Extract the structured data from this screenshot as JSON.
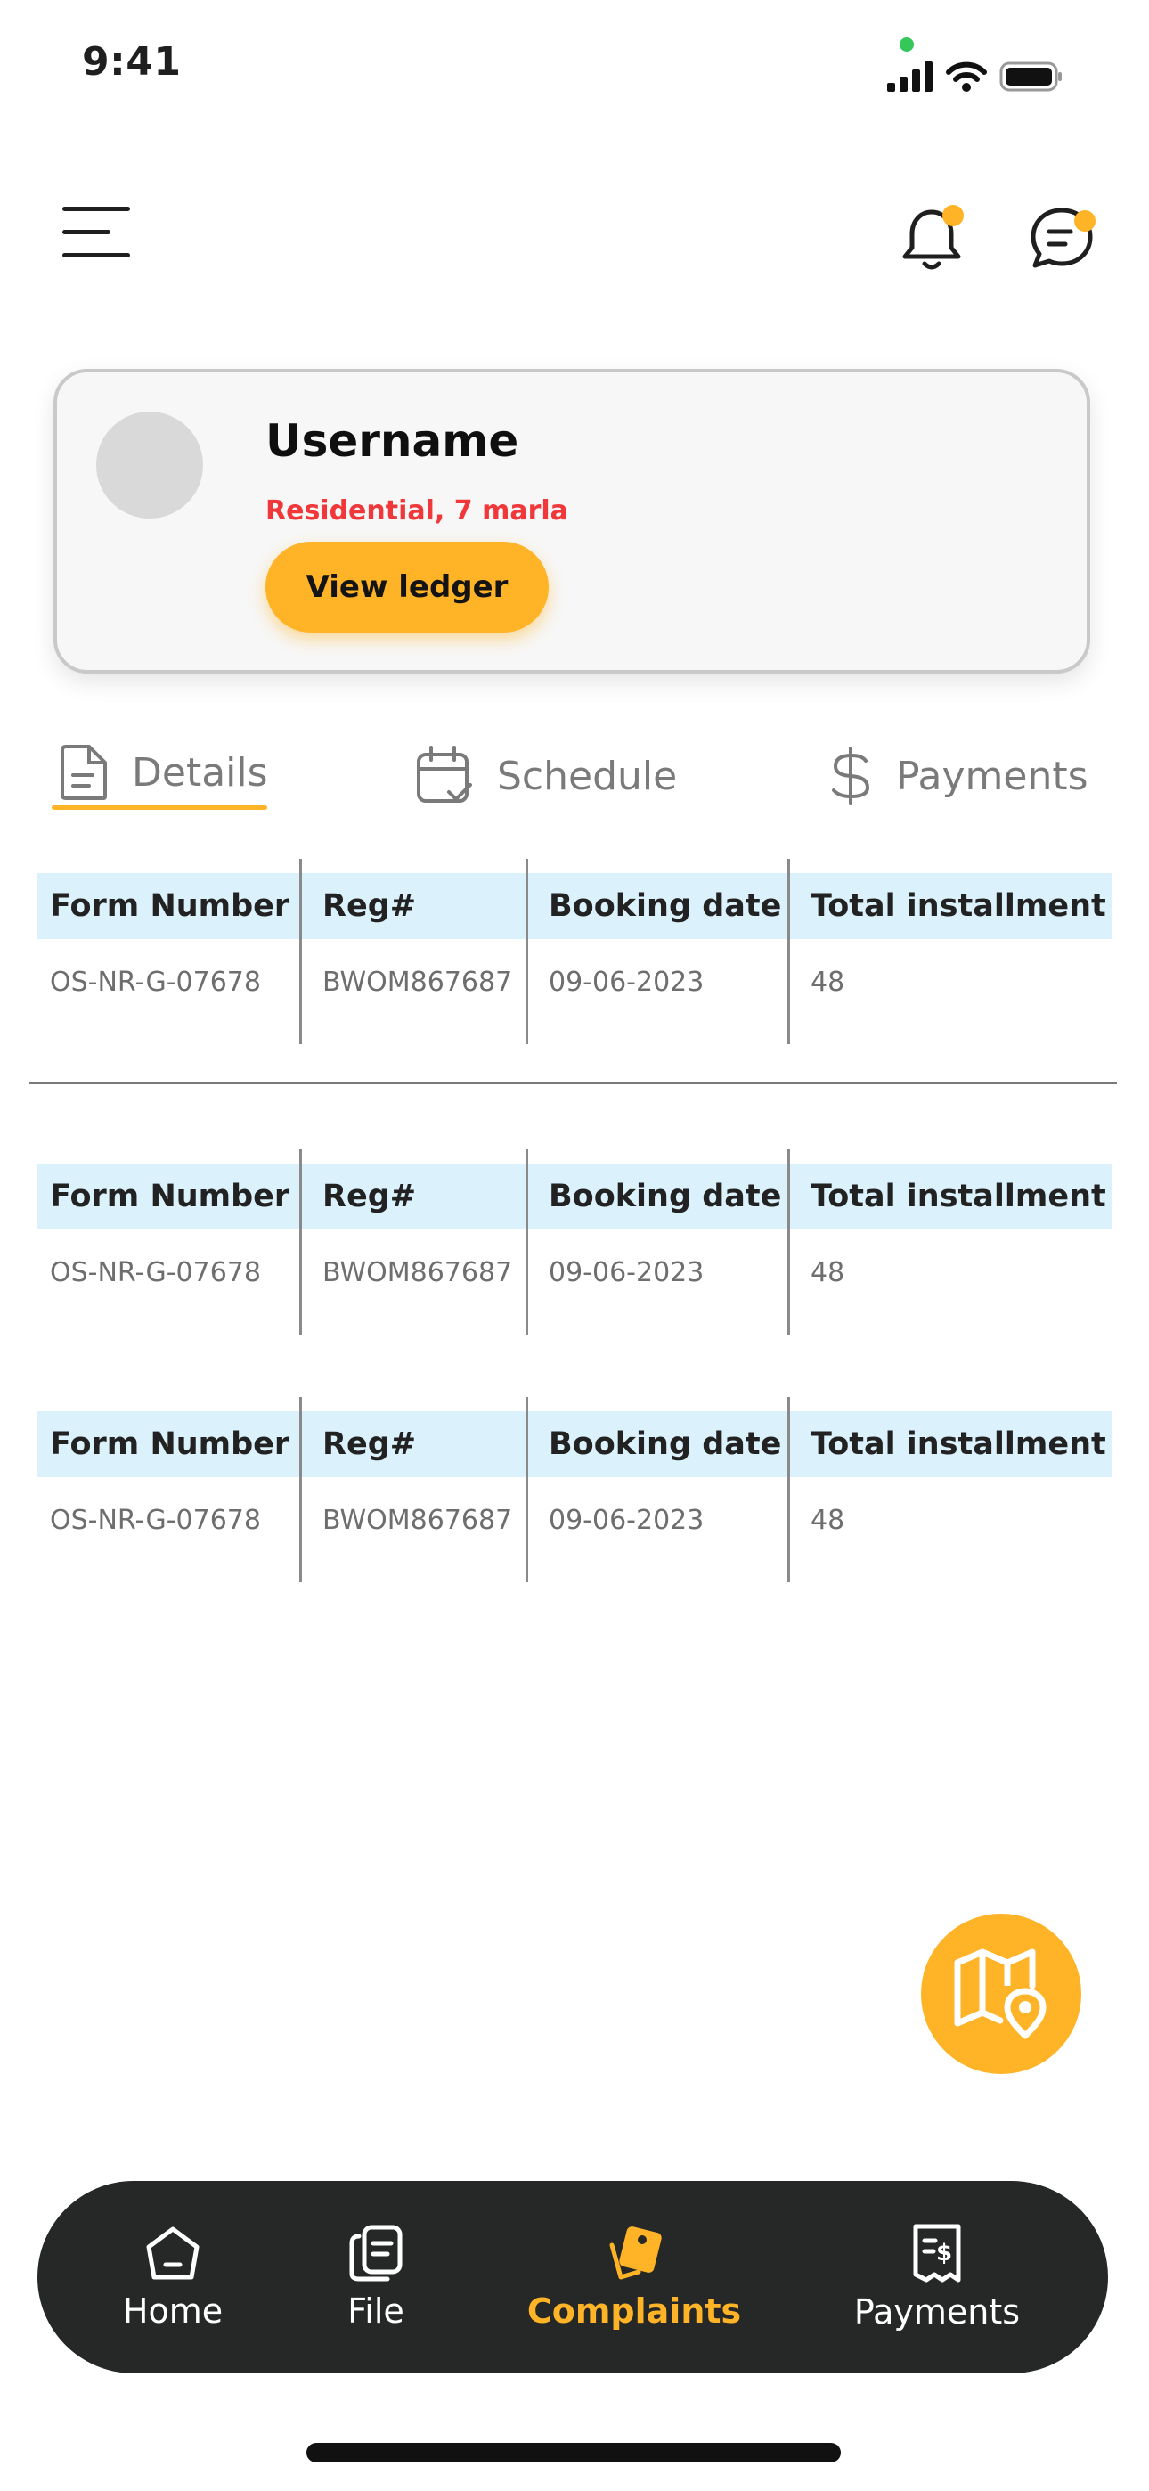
{
  "status_bar": {
    "time": "9:41"
  },
  "header": {
    "menu_icon": "hamburger-menu-icon",
    "notifications_icon": "bell-icon",
    "messages_icon": "chat-bubble-icon",
    "badge_color": "#ffb326"
  },
  "profile": {
    "username": "Username",
    "subtitle": "Residential, 7 marla",
    "view_ledger_label": "View ledger"
  },
  "tabs": [
    {
      "label": "Details",
      "icon": "document-icon",
      "active": true
    },
    {
      "label": "Schedule",
      "icon": "calendar-check-icon",
      "active": false
    },
    {
      "label": "Payments",
      "icon": "dollar-icon",
      "active": false
    }
  ],
  "tables": [
    {
      "headers": [
        "Form Number",
        "Reg#",
        "Booking date",
        "Total installment"
      ],
      "row": [
        "OS-NR-G-07678",
        "BWOM867687",
        "09-06-2023",
        "48"
      ]
    },
    {
      "headers": [
        "Form Number",
        "Reg#",
        "Booking date",
        "Total installment"
      ],
      "row": [
        "OS-NR-G-07678",
        "BWOM867687",
        "09-06-2023",
        "48"
      ]
    },
    {
      "headers": [
        "Form Number",
        "Reg#",
        "Booking date",
        "Total installment"
      ],
      "row": [
        "OS-NR-G-07678",
        "BWOM867687",
        "09-06-2023",
        "48"
      ]
    }
  ],
  "fab": {
    "icon": "map-location-icon"
  },
  "bottom_nav": [
    {
      "label": "Home",
      "icon": "home-icon",
      "active": false
    },
    {
      "label": "File",
      "icon": "files-icon",
      "active": false
    },
    {
      "label": "Complaints",
      "icon": "tags-icon",
      "active": true
    },
    {
      "label": "Payments",
      "icon": "receipt-dollar-icon",
      "active": false
    }
  ],
  "colors": {
    "accent": "#ffb326",
    "subtitle_red": "#f0383a",
    "table_header_bg": "#dbf1fc",
    "nav_bg": "#262828"
  }
}
